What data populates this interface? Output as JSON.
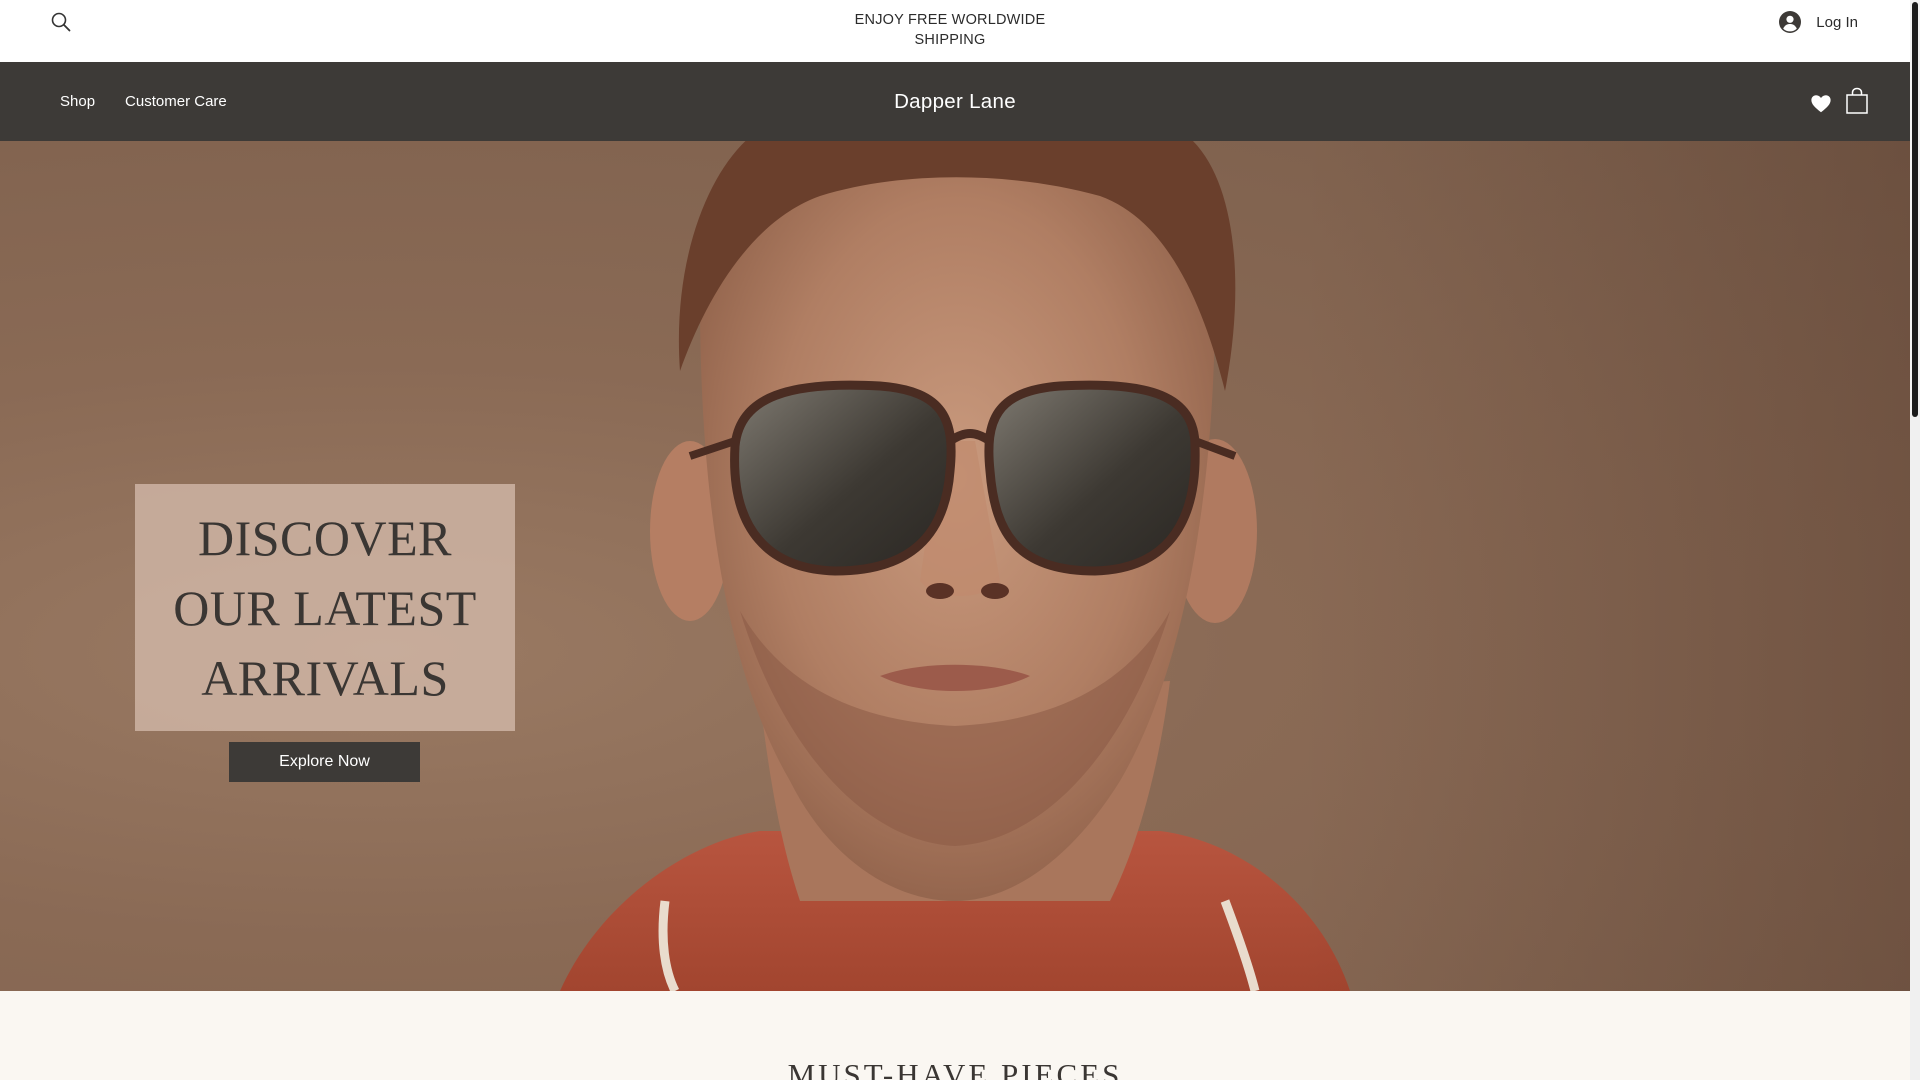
{
  "topbar": {
    "announcement": "ENJOY FREE WORLDWIDE SHIPPING",
    "search_icon": "search-icon",
    "login_label": "Log In",
    "login_icon": "user-avatar-icon"
  },
  "navbar": {
    "links": [
      {
        "label": "Shop"
      },
      {
        "label": "Customer Care"
      }
    ],
    "brand": "Dapper Lane",
    "wishlist_icon": "heart-icon",
    "cart_icon": "shopping-bag-icon"
  },
  "hero": {
    "heading_lines": [
      "DISCOVER",
      "OUR LATEST",
      "ARRIVALS"
    ],
    "cta_label": "Explore Now"
  },
  "section": {
    "title": "MUST-HAVE PIECES"
  },
  "colors": {
    "nav_bg": "#3d3a37",
    "hero_card": "#d4baaa",
    "cta_bg": "#3d3a37",
    "section_bg": "#faf7f2",
    "text_dark": "#3a3633"
  }
}
